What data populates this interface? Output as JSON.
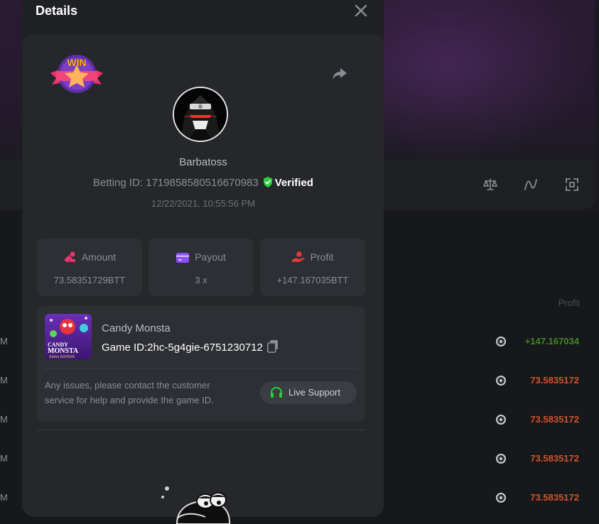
{
  "modal": {
    "title": "Details",
    "username": "Barbatoss",
    "betting_id": "Betting ID: 1719858580516670983",
    "verified_label": "Verified",
    "datetime": "12/22/2021, 10:55:56 PM",
    "win_badge_text": "WIN",
    "stats": [
      {
        "label": "Amount",
        "value": "73.58351729BTT",
        "icon": "coins-icon",
        "color": "#e8336d"
      },
      {
        "label": "Payout",
        "value": "3 x",
        "icon": "card-icon",
        "color": "#8a4dff"
      },
      {
        "label": "Profit",
        "value": "+147.167035BTT",
        "icon": "hand-coin-icon",
        "color": "#e03b3b"
      }
    ],
    "game": {
      "name": "Candy Monsta",
      "id_text": "Game ID:2hc-5g4gie-6751230712",
      "thumb_lines": [
        "CANDY",
        "MONSTA",
        "XMAS EDITION"
      ],
      "support_text_1": "Any issues, please contact the customer",
      "support_text_2": "service for help and provide the game ID.",
      "support_button": "Live Support"
    }
  },
  "background": {
    "column_header": "Profit",
    "rows": [
      {
        "time": "M",
        "profit": "+147.167034",
        "positive": true
      },
      {
        "time": "M",
        "profit": "73.5835172",
        "positive": false
      },
      {
        "time": "M",
        "profit": "73.5835172",
        "positive": false
      },
      {
        "time": "M",
        "profit": "73.5835172",
        "positive": false
      },
      {
        "time": "M",
        "profit": "73.5835172",
        "positive": false
      }
    ]
  },
  "colors": {
    "verified_green": "#2ecc40",
    "positive_profit": "#3d8b1e",
    "negative_profit": "#d1532a",
    "support_icon_green": "#2ecc40"
  }
}
